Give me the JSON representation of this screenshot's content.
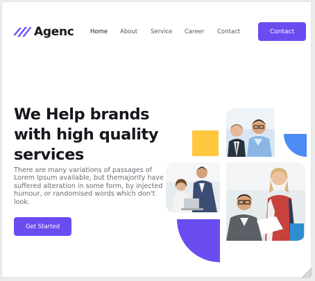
{
  "brand": {
    "name": "Agenc",
    "accent": "#6a4cf0"
  },
  "nav": {
    "items": [
      {
        "label": "Home",
        "active": true
      },
      {
        "label": "About",
        "active": false
      },
      {
        "label": "Service",
        "active": false
      },
      {
        "label": "Career",
        "active": false
      },
      {
        "label": "Contact",
        "active": false
      }
    ],
    "cta_label": "Contact"
  },
  "hero": {
    "title_lines": [
      "We Help brands",
      "with high quality",
      "services"
    ],
    "description": "There are many variations of passages of Lorem Ipsum available, but themajority have suffered alteration in some form, by injected humour, or randomised words which don't look.",
    "cta_label": "Get Started"
  },
  "collage": {
    "colors": {
      "yellow": "#ffc640",
      "blue": "#4d8bf5",
      "purple": "#6a4cf0"
    },
    "photos": [
      "two-businessmen-photo",
      "team-at-laptop-photo",
      "smiling-colleagues-photo"
    ]
  }
}
